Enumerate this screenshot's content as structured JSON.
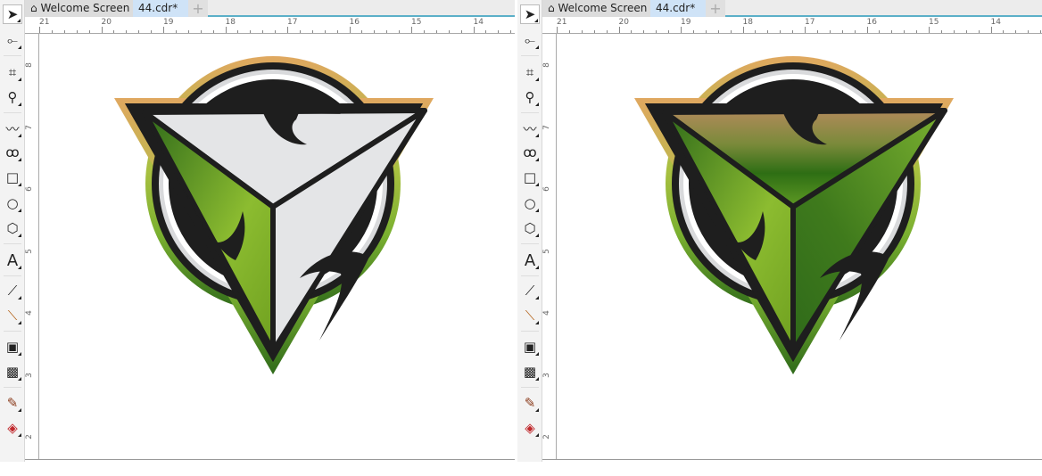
{
  "panels": [
    {
      "tabs": {
        "home_icon": "home-icon",
        "welcome": "Welcome Screen",
        "document": "44.cdr*",
        "add": "+"
      },
      "ruler": {
        "horizontal": [
          "21",
          "20",
          "19",
          "18",
          "17",
          "16",
          "15",
          "14"
        ],
        "vertical": [
          "8",
          "7",
          "6",
          "5",
          "4",
          "3",
          "2"
        ]
      },
      "logo_variant": "gray top and right faces, green left face"
    },
    {
      "tabs": {
        "home_icon": "home-icon",
        "welcome": "Welcome Screen",
        "document": "44.cdr*",
        "add": "+"
      },
      "ruler": {
        "horizontal": [
          "21",
          "20",
          "19",
          "18",
          "17",
          "16",
          "15",
          "14"
        ],
        "vertical": [
          "8",
          "7",
          "6",
          "5",
          "4",
          "3",
          "2"
        ]
      },
      "logo_variant": "brown-to-green top face, green side faces"
    }
  ],
  "toolbox": [
    "pick-tool",
    "shape-tool",
    "crop-tool",
    "zoom-tool",
    "freehand-tool",
    "artistic-media-tool",
    "rectangle-tool",
    "ellipse-tool",
    "polygon-tool",
    "text-tool",
    "dimension-tool",
    "connector-tool",
    "contour-tool",
    "transparency-tool",
    "eyedropper-tool",
    "interactive-fill-tool"
  ],
  "colors": {
    "accent": "#5bb0c8",
    "logo_green": "#7ab030",
    "logo_dark_green": "#2f6a1a",
    "logo_gold": "#e0a860",
    "logo_gray": "#e6e7e9"
  }
}
